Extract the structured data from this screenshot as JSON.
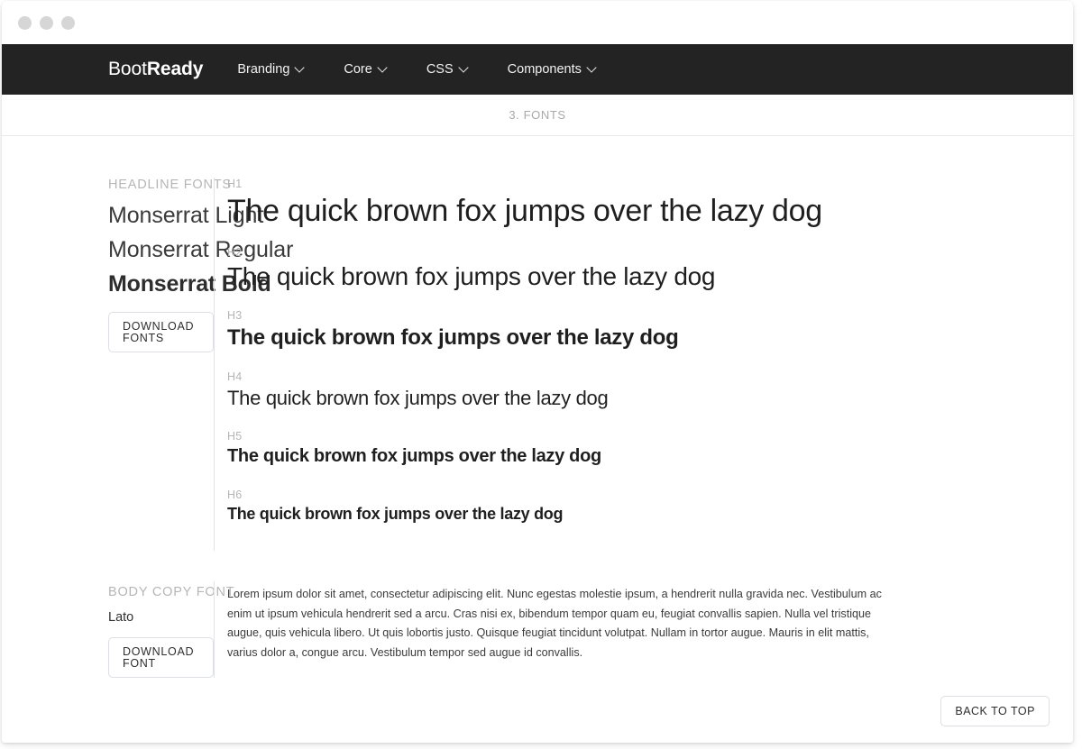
{
  "window": {
    "traffic_lights": [
      "close",
      "minimize",
      "maximize"
    ]
  },
  "navbar": {
    "brand_light": "Boot",
    "brand_bold": "Ready",
    "items": [
      {
        "label": "Branding",
        "icon": "chevron-down-icon"
      },
      {
        "label": "Core",
        "icon": "chevron-down-icon"
      },
      {
        "label": "CSS",
        "icon": "chevron-down-icon"
      },
      {
        "label": "Components",
        "icon": "chevron-down-icon"
      }
    ]
  },
  "breadcrumb": {
    "text": "3. FONTS"
  },
  "headline_section": {
    "label": "HEADLINE FONTS",
    "fonts": [
      {
        "name": "Monserrat Light",
        "weight": "light"
      },
      {
        "name": "Monserrat Regular",
        "weight": "regular"
      },
      {
        "name": "Monserrat Bold",
        "weight": "bold"
      }
    ],
    "download_button": "DOWNLOAD FONTS",
    "specimens": [
      {
        "tag": "H1",
        "text": "The quick brown fox jumps over the lazy dog"
      },
      {
        "tag": "H2",
        "text": "The quick brown fox jumps over the lazy dog"
      },
      {
        "tag": "H3",
        "text": "The quick brown fox jumps over the lazy dog"
      },
      {
        "tag": "H4",
        "text": "The quick brown fox jumps over the lazy dog"
      },
      {
        "tag": "H5",
        "text": "The quick brown fox jumps over the lazy dog"
      },
      {
        "tag": "H6",
        "text": "The quick brown fox jumps over the lazy dog"
      }
    ]
  },
  "body_section": {
    "label": "BODY COPY FONT",
    "font_name": "Lato",
    "download_button": "DOWNLOAD FONT",
    "copy": "Lorem ipsum dolor sit amet, consectetur adipiscing elit. Nunc egestas molestie ipsum, a hendrerit nulla gravida nec. Vestibulum ac enim ut ipsum vehicula hendrerit sed a arcu. Cras nisi ex, bibendum tempor quam eu, feugiat convallis sapien. Nulla vel tristique augue, quis vehicula libero. Ut quis lobortis justo. Quisque feugiat tincidunt volutpat. Nullam in tortor augue. Mauris in elit mattis, varius dolor a, congue arcu. Vestibulum tempor sed augue id convallis."
  },
  "footer": {
    "back_to_top": "BACK TO TOP"
  },
  "colors": {
    "navbar_bg": "#232323",
    "page_bg": "#ffffff",
    "muted_text": "#b6b6b6",
    "body_text": "#3b3b3b",
    "border": "#e3e3e3"
  }
}
